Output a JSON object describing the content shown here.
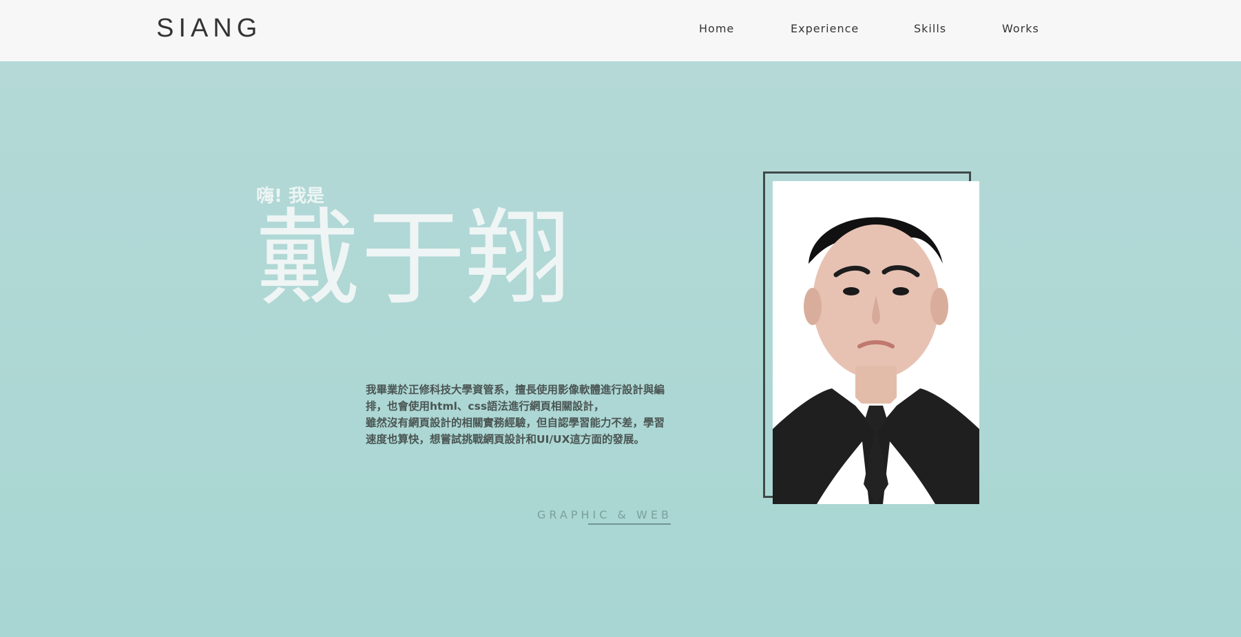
{
  "header": {
    "logo": "SIANG",
    "nav": [
      "Home",
      "Experience",
      "Skills",
      "Works"
    ]
  },
  "hero": {
    "greeting": "嗨! 我是",
    "name": "戴于翔",
    "intro_lines": [
      "我畢業於正修科技大學資管系，擅長使用影像軟體進行設計與編",
      "排，也會使用html、css語法進行網頁相關設計，",
      "雖然沒有網頁設計的相關實務經驗，但自認學習能力不差，學習",
      "速度也算快，想嘗試挑戰網頁設計和UI/UX這方面的發展。"
    ],
    "tagline": "GRAPHIC & WEB"
  },
  "colors": {
    "header_bg": "#f7f7f7",
    "hero_bg": "#a9d7d4",
    "text_dark": "#333333",
    "frame": "#3f4a49"
  },
  "icons": [
    "portrait-photo"
  ]
}
